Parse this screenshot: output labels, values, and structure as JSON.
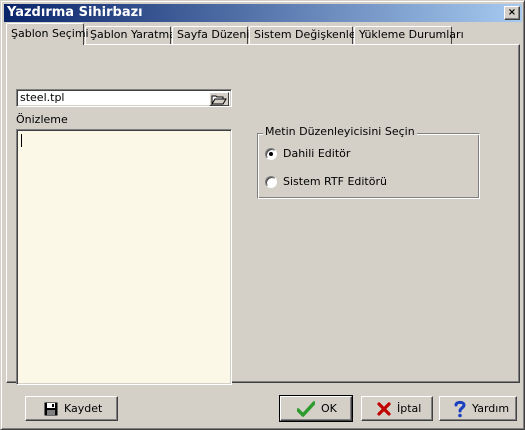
{
  "window": {
    "title": "Yazdırma Sihirbazı",
    "close_glyph": "×",
    "title_gradient_start": "#0a246a",
    "title_gradient_end": "#a6caf0"
  },
  "tabs": [
    {
      "label": "Şablon Seçimi",
      "active": true
    },
    {
      "label": "Şablon Yaratma",
      "active": false
    },
    {
      "label": "Sayfa Düzeni",
      "active": false
    },
    {
      "label": "Sistem Değişkenleri",
      "active": false
    },
    {
      "label": "Yükleme Durumları",
      "active": false
    }
  ],
  "template": {
    "file_value": "steel.tpl",
    "browse_icon": "folder-open-icon",
    "preview_label": "Önizleme"
  },
  "editor_group": {
    "legend": "Metin Düzenleyicisini Seçin",
    "options": [
      {
        "label": "Dahili Editör",
        "selected": true
      },
      {
        "label": "Sistem RTF Editörü",
        "selected": false
      }
    ]
  },
  "buttons": {
    "save": {
      "label": "Kaydet",
      "icon": "floppy-disk-icon"
    },
    "ok": {
      "label": "OK",
      "icon": "checkmark-icon",
      "color": "#2e9b2e"
    },
    "cancel": {
      "label": "İptal",
      "icon": "x-icon",
      "color": "#c00000"
    },
    "help": {
      "label": "Yardım",
      "icon": "question-mark-icon",
      "color": "#1a3fbf"
    }
  }
}
